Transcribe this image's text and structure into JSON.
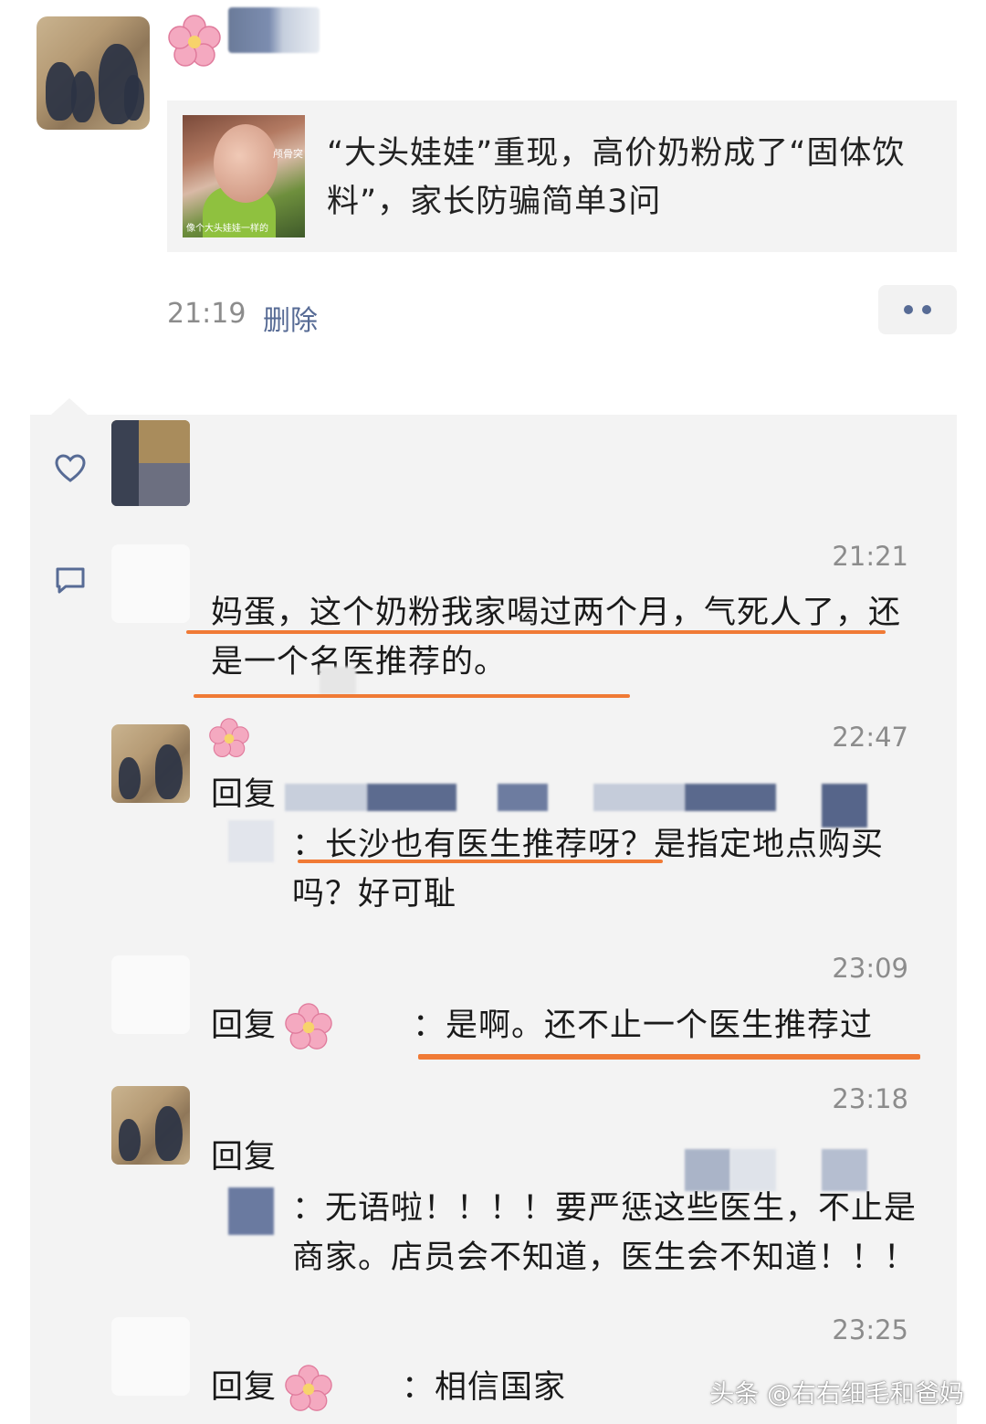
{
  "post": {
    "article_title": "“大头娃娃”重现，高价奶粉成了“固体饮料”，家长防骗简单3问",
    "thumb_overlay_top": "颅骨突",
    "thumb_overlay_bottom": "像个大头娃娃一样的",
    "time": "21:19",
    "delete_label": "删除"
  },
  "comments": [
    {
      "time": "21:21",
      "text": "妈蛋，这个奶粉我家喝过两个月，气死人了，还是一个名医推荐的。"
    },
    {
      "time": "22:47",
      "reply_prefix": "回复",
      "text": "：长沙也有医生推荐呀？是指定地点购买吗？好可耻"
    },
    {
      "time": "23:09",
      "reply_prefix": "回复",
      "text": "：是啊。还不止一个医生推荐过"
    },
    {
      "time": "23:18",
      "reply_prefix": "回复",
      "text": "：无语啦！！！！要严惩这些医生，不止是商家。店员会不知道，医生会不知道！！！"
    },
    {
      "time": "23:25",
      "reply_prefix": "回复",
      "text": "：相信国家"
    }
  ],
  "icons": {
    "like": "heart-outline-icon",
    "comment": "speech-bubble-icon",
    "more": "more-dots-icon",
    "flower": "cherry-blossom-emoji"
  },
  "colors": {
    "link": "#576b95",
    "underline": "#f07a35",
    "panel": "#f3f3f3"
  },
  "watermark": "头条 @右右细毛和爸妈"
}
